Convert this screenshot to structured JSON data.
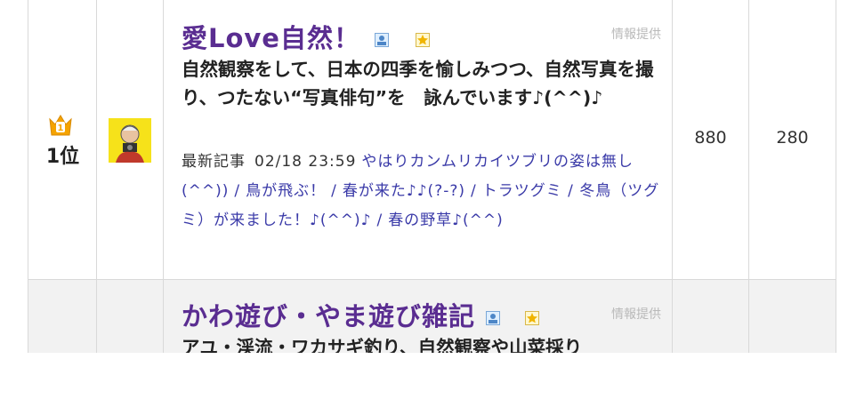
{
  "rows": [
    {
      "rank": "1位",
      "title": "愛Love自然！",
      "info_label": "情報提供",
      "description": "自然観察をして、日本の四季を愉しみつつ、自然写真を撮り、つたない“写真俳句”を　詠んでいます♪(^^)♪",
      "latest_label": "最新記事",
      "latest_date": "02/18 23:59",
      "articles": [
        "やはりカンムリカイツブリの姿は無し(^^))",
        "鳥が飛ぶ！",
        "春が来た♪♪(?-?)",
        "トラツグミ / 冬鳥（ツグミ）が来ました！♪(^^)♪",
        "春の野草♪(^^)"
      ],
      "in_points": "880",
      "out_points": "280"
    },
    {
      "title": "かわ遊び・やま遊び雑記",
      "info_label": "情報提供",
      "description": "アユ・渓流・ワカサギ釣り、自然観察や山菜採り"
    }
  ],
  "icons": {
    "rank_crown": "crown-icon",
    "profile": "profile-card-icon",
    "favorite": "star-badge-icon"
  },
  "colors": {
    "title": "#5a2d91",
    "link": "#3a3aa8",
    "crown": "#f5a300"
  }
}
